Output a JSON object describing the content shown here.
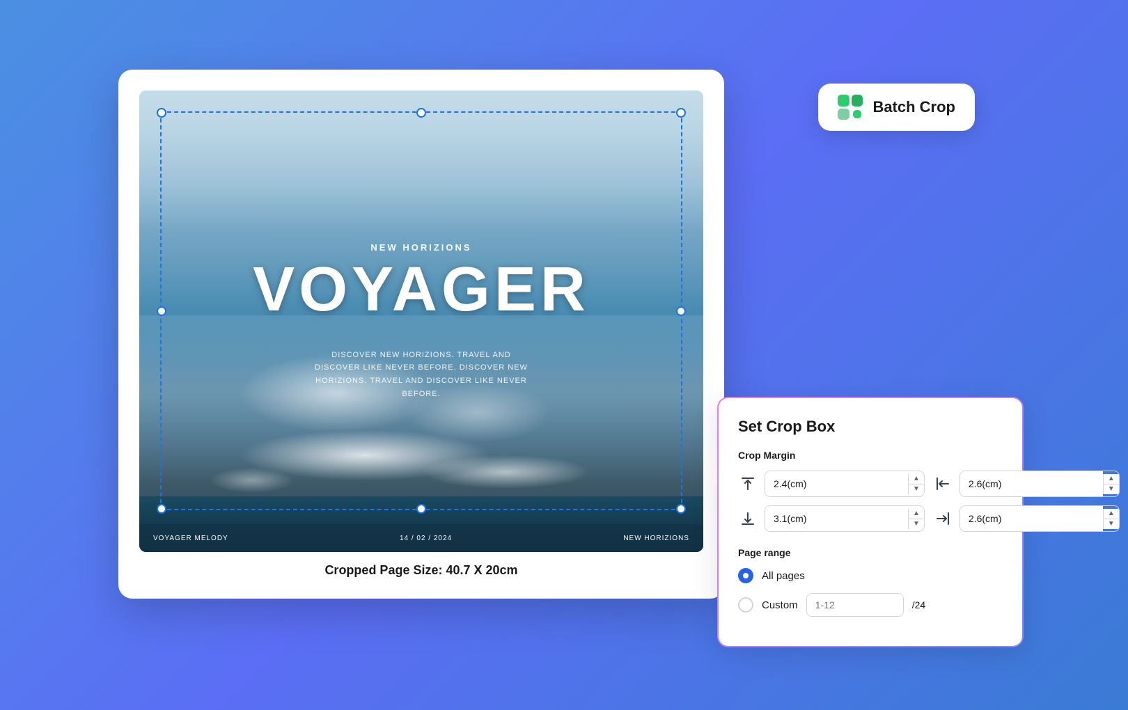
{
  "background": {
    "gradient_start": "#4a90e2",
    "gradient_end": "#3a7bd5"
  },
  "pdf_preview": {
    "subtitle": "NEW HORIZIONS",
    "main_title": "VOYAGER",
    "description": "DISCOVER NEW HORIZIONS. TRAVEL AND DISCOVER LIKE NEVER BEFORE. DISCOVER NEW HORIZIONS. TRAVEL AND DISCOVER LIKE NEVER BEFORE.",
    "footer_left": "VOYAGER MELODY",
    "footer_center": "14 / 02 / 2024",
    "footer_right": "NEW HORIZIONS",
    "cropped_size_label": "Cropped Page Size: 40.7 X 20cm"
  },
  "batch_crop_button": {
    "label": "Batch Crop"
  },
  "crop_panel": {
    "title": "Set Crop Box",
    "crop_margin_label": "Crop Margin",
    "top_margin": "2.4(cm)",
    "left_margin": "2.6(cm)",
    "bottom_margin": "3.1(cm)",
    "right_margin": "2.6(cm)",
    "page_range_label": "Page range",
    "all_pages_label": "All pages",
    "custom_label": "Custom",
    "custom_placeholder": "1-12",
    "total_pages": "/24"
  }
}
